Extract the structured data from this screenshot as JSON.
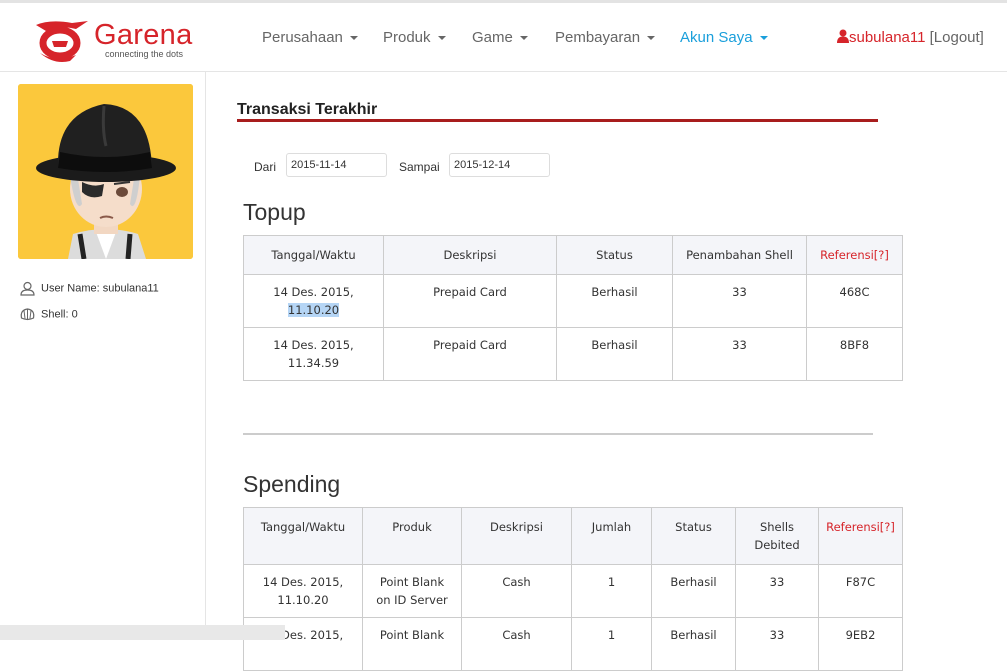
{
  "header": {
    "logo_text": "Garena",
    "logo_tagline": "connecting the dots",
    "nav": [
      {
        "label": "Perusahaan"
      },
      {
        "label": "Produk"
      },
      {
        "label": "Game"
      },
      {
        "label": "Pembayaran"
      },
      {
        "label": "Akun Saya",
        "active": true
      }
    ],
    "user": {
      "name": "subulana11",
      "logout": "[Logout]"
    }
  },
  "sidebar": {
    "username_label": "User Name: subulana11",
    "shell_label": "Shell: 0"
  },
  "main": {
    "title": "Transaksi Terakhir",
    "filter": {
      "from_label": "Dari",
      "from_value": "2015-11-14",
      "to_label": "Sampai",
      "to_value": "2015-12-14"
    },
    "topup": {
      "heading": "Topup",
      "columns": [
        "Tanggal/Waktu",
        "Deskripsi",
        "Status",
        "Penambahan Shell",
        "Referensi[?]"
      ],
      "rows": [
        {
          "date": "14 Des. 2015,",
          "time": "11.10.20",
          "desc": "Prepaid Card",
          "status": "Berhasil",
          "shell": "33",
          "ref": "468C"
        },
        {
          "date": "14 Des. 2015,",
          "time": "11.34.59",
          "desc": "Prepaid Card",
          "status": "Berhasil",
          "shell": "33",
          "ref": "8BF8"
        }
      ]
    },
    "spending": {
      "heading": "Spending",
      "columns": [
        "Tanggal/Waktu",
        "Produk",
        "Deskripsi",
        "Jumlah",
        "Status",
        "Shells",
        "Debited",
        "Referensi[?]"
      ],
      "rows": [
        {
          "date": "14 Des. 2015,",
          "time": "11.10.20",
          "product1": "Point Blank",
          "product2": "on ID Server",
          "desc": "Cash",
          "qty": "1",
          "status": "Berhasil",
          "shells": "33",
          "ref": "F87C"
        },
        {
          "date": "14 Des. 2015,",
          "product1": "Point Blank",
          "desc": "Cash",
          "qty": "1",
          "status": "Berhasil",
          "shells": "33",
          "ref": "9EB2"
        }
      ]
    }
  },
  "colors": {
    "brand_red": "#d6242a",
    "active_blue": "#1a9fdb",
    "accent_line": "#a81d1d",
    "avatar_bg": "#fbc83c"
  }
}
